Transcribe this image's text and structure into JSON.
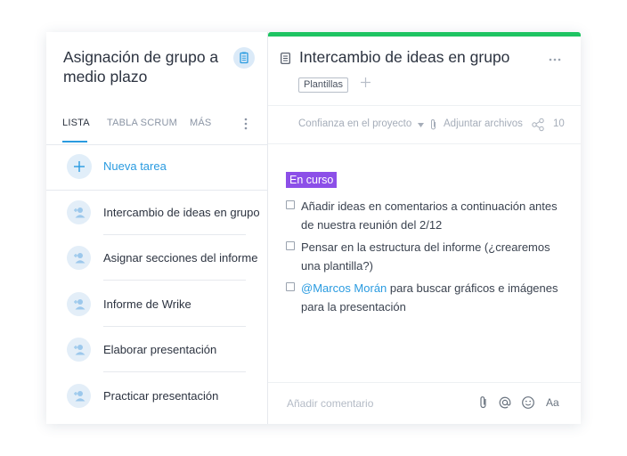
{
  "project": {
    "title": "Asignación de grupo a medio plazo"
  },
  "tabs": [
    {
      "label": "LISTA"
    },
    {
      "label": "TABLA SCRUM"
    },
    {
      "label": "MÁS"
    }
  ],
  "new_task_label": "Nueva tarea",
  "tasks": [
    {
      "label": "Intercambio de ideas en grupo"
    },
    {
      "label": "Asignar secciones del informe"
    },
    {
      "label": "Informe de Wrike"
    },
    {
      "label": "Elaborar presentación"
    },
    {
      "label": "Practicar presentación"
    }
  ],
  "detail": {
    "title": "Intercambio de ideas en grupo",
    "tag": "Plantillas",
    "meta": {
      "confidence": "Confianza en el proyecto",
      "attach": "Adjuntar archivos",
      "share_count": "10"
    },
    "status": "En curso",
    "checklist": [
      {
        "text": "Añadir ideas en comentarios a continuación antes de nuestra reunión del 2/12"
      },
      {
        "text": "Pensar en la estructura del informe (¿crearemos una plantilla?)"
      },
      {
        "mention": "@Marcos Morán",
        "text": " para buscar gráficos e imágenes para la presentación"
      }
    ],
    "comment_placeholder": "Añadir comentario",
    "format_label": "Aa"
  },
  "colors": {
    "accent": "#2a9be0",
    "status": "#8c4fe8",
    "top_bar": "#1ec462"
  },
  "icons": [
    "clipboard-icon",
    "plus-icon",
    "user-add-icon",
    "document-icon",
    "more-dots-icon",
    "paperclip-icon",
    "share-icon",
    "at-icon",
    "smiley-icon"
  ]
}
